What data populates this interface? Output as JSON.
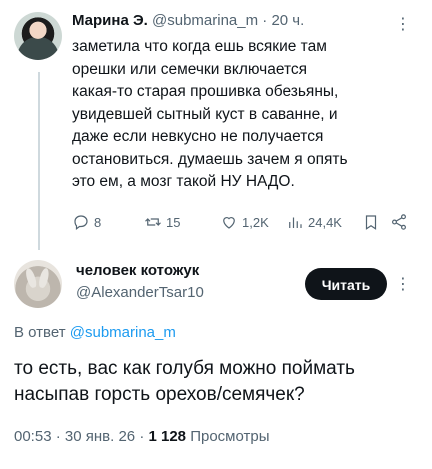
{
  "original_tweet": {
    "author_name": "Марина Э.",
    "handle": "@submarina_m",
    "time": "20 ч.",
    "text": "заметила что когда ешь всякие там\nорешки или семечки включается\nкакая-то старая прошивка обезьяны,\nувидевшей сытный куст в саванне, и\nдаже если невкусно не получается\nостановиться. думаешь зачем я опять\nэто ем, а мозг такой НУ НАДО.",
    "actions": {
      "replies": "8",
      "retweets": "15",
      "likes": "1,2K",
      "views": "24,4K"
    }
  },
  "reply_tweet": {
    "author_name": "человек котожук",
    "handle": "@AlexanderTsar10",
    "follow_label": "Читать",
    "reply_to_prefix": "В ответ",
    "reply_to_handle": "@submarina_m",
    "text": "то есть, вас как голубя можно поймать насыпав горсть орехов/семячек?",
    "time": "00:53",
    "date": "30 янв. 26",
    "views_count": "1 128",
    "views_label": "Просмотры"
  },
  "colors": {
    "text": "#0f1419",
    "muted": "#536471",
    "link": "#1d9bf0",
    "button_bg": "#0f1419"
  }
}
